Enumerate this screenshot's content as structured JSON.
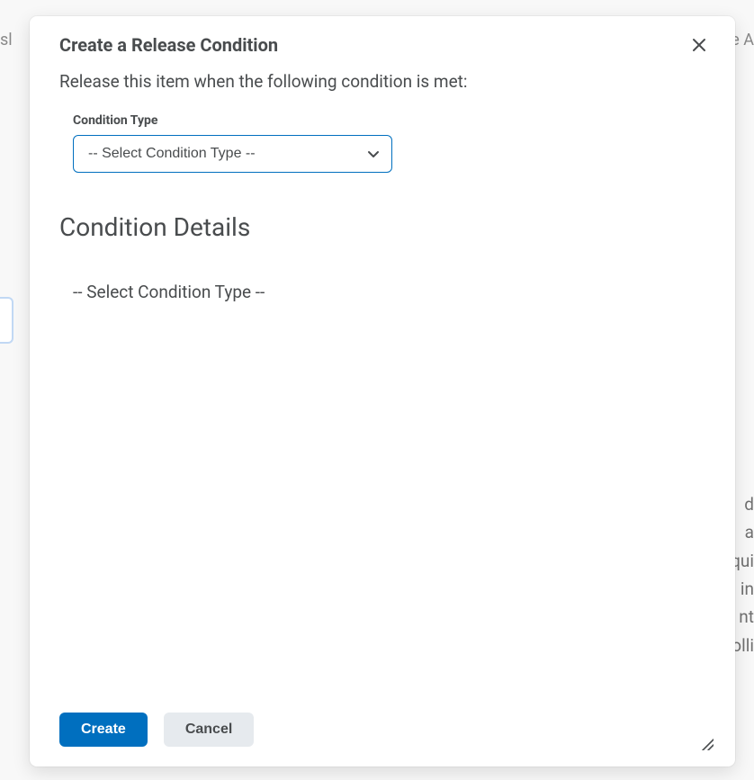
{
  "modal": {
    "title": "Create a Release Condition",
    "subtitle": "Release this item when the following condition is met:",
    "conditionTypeLabel": "Condition Type",
    "conditionTypeSelected": "-- Select Condition Type --",
    "detailsHeading": "Condition Details",
    "detailsPlaceholder": "-- Select Condition Type --",
    "createLabel": "Create",
    "cancelLabel": "Cancel"
  },
  "background": {
    "leftFragment": "sl",
    "rightFragment": "e A",
    "rightLower": [
      "d",
      "a",
      "qui",
      "in",
      "nt",
      "olli"
    ]
  }
}
